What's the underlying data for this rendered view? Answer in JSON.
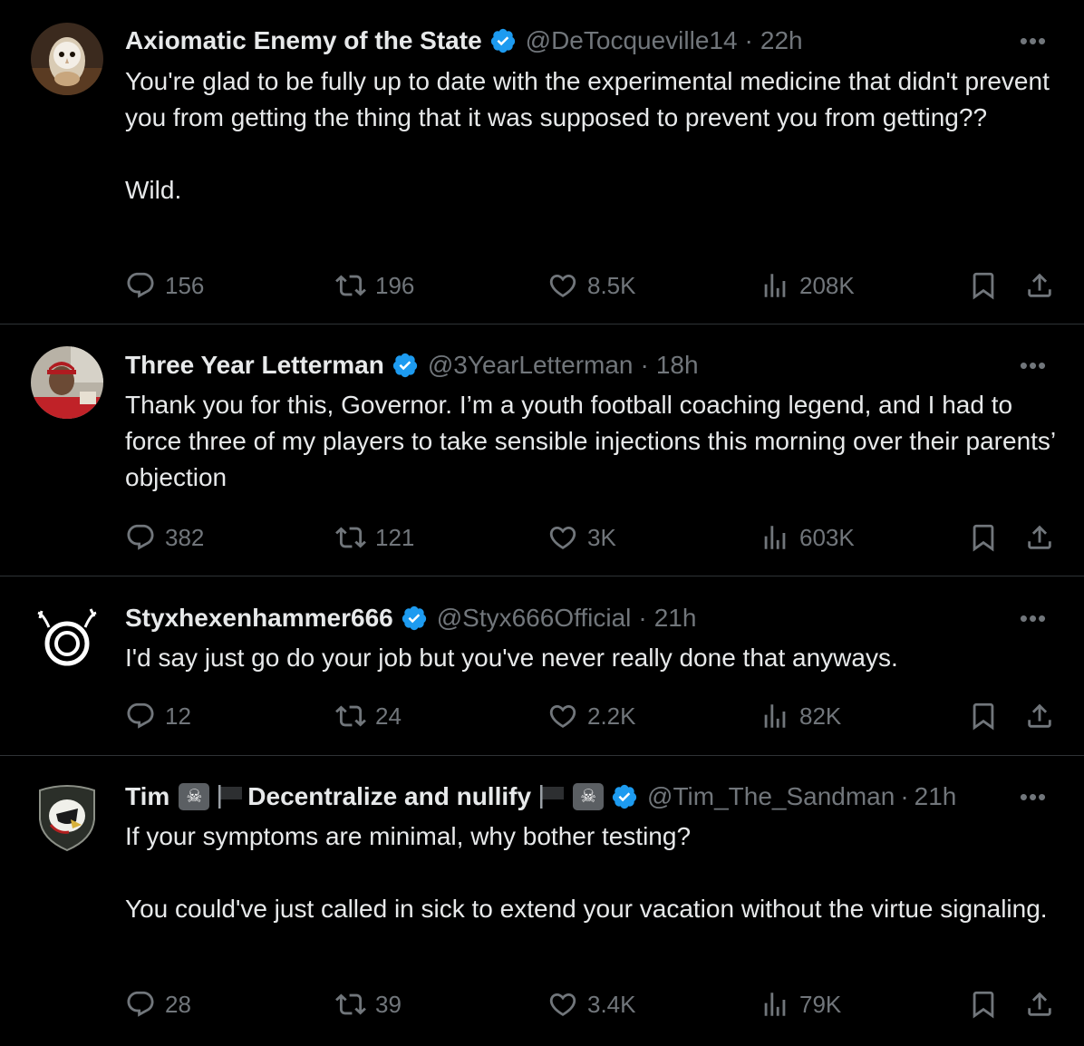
{
  "tweets": [
    {
      "name": "Axiomatic Enemy of the State",
      "handle": "@DeTocqueville14",
      "time": "22h",
      "text": "You're glad to be fully up to date with the experimental medicine that didn't prevent you from getting the thing that it was supposed to prevent you from getting??\n\nWild.",
      "replies": "156",
      "retweets": "196",
      "likes": "8.5K",
      "views": "208K"
    },
    {
      "name": "Three Year Letterman",
      "handle": "@3YearLetterman",
      "time": "18h",
      "text": "Thank you for this, Governor. I’m a youth football coaching legend, and I had to force three of my players to take sensible injections this morning over their parents’ objection",
      "replies": "382",
      "retweets": "121",
      "likes": "3K",
      "views": "603K"
    },
    {
      "name": "Styxhexenhammer666",
      "handle": "@Styx666Official",
      "time": "21h",
      "text": "I'd say just go do your job but you've never really done that anyways.",
      "replies": "12",
      "retweets": "24",
      "likes": "2.2K",
      "views": "82K"
    },
    {
      "name_part1": "Tim",
      "name_part2": "Decentralize and nullify",
      "skull_emoji": "☠",
      "handle": "@Tim_The_Sandman",
      "time": "21h",
      "text": "If your symptoms are minimal, why bother testing?\n\nYou could've just called in sick to extend your vacation without the virtue signaling.",
      "replies": "28",
      "retweets": "39",
      "likes": "3.4K",
      "views": "79K"
    }
  ],
  "ui": {
    "dot": "·",
    "more": "•••"
  },
  "colors": {
    "background": "#000000",
    "text": "#e7e9ea",
    "secondary": "#71767b",
    "verified": "#1d9bf0",
    "divider": "#2f3336"
  },
  "icons": [
    "reply-icon",
    "retweet-icon",
    "like-icon",
    "views-icon",
    "bookmark-icon",
    "share-icon",
    "verified-badge-icon",
    "more-icon"
  ]
}
